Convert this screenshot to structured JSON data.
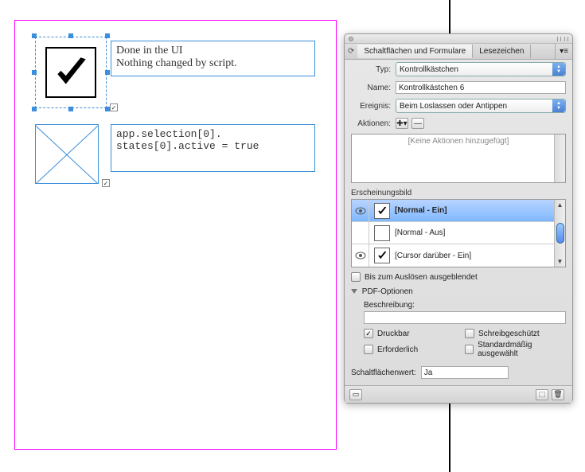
{
  "canvas": {
    "label1_line1": "Done in the UI",
    "label1_line2": "Nothing changed by script.",
    "label2_line1": "app.selection[0].",
    "label2_line2": "states[0].active = true"
  },
  "panel": {
    "tabs": {
      "buttons": "Schaltflächen und Formulare",
      "bookmarks": "Lesezeichen"
    },
    "labels": {
      "type": "Typ:",
      "name": "Name:",
      "event": "Ereignis:",
      "actions": "Aktionen:",
      "appearance": "Erscheinungsbild",
      "hiddenUntil": "Bis zum Auslösen ausgeblendet",
      "pdfOptions": "PDF-Optionen",
      "description": "Beschreibung:",
      "printable": "Druckbar",
      "readonly": "Schreibgeschützt",
      "required": "Erforderlich",
      "defaultSelected": "Standardmäßig ausgewählt",
      "buttonValue": "Schaltflächenwert:"
    },
    "values": {
      "type": "Kontrollkästchen",
      "name": "Kontrollkästchen 6",
      "event": "Beim Loslassen oder Antippen",
      "noActions": "[Keine Aktionen hinzugefügt]",
      "buttonValue": "Ja"
    },
    "states": [
      {
        "label": "[Normal - Ein]",
        "check": true,
        "selected": true
      },
      {
        "label": "[Normal - Aus]",
        "check": false,
        "selected": false
      },
      {
        "label": "[Cursor darüber - Ein]",
        "check": true,
        "selected": false
      }
    ],
    "checkboxes": {
      "printable": true,
      "readonly": false,
      "required": false,
      "defaultSelected": false,
      "hiddenUntil": false
    }
  }
}
